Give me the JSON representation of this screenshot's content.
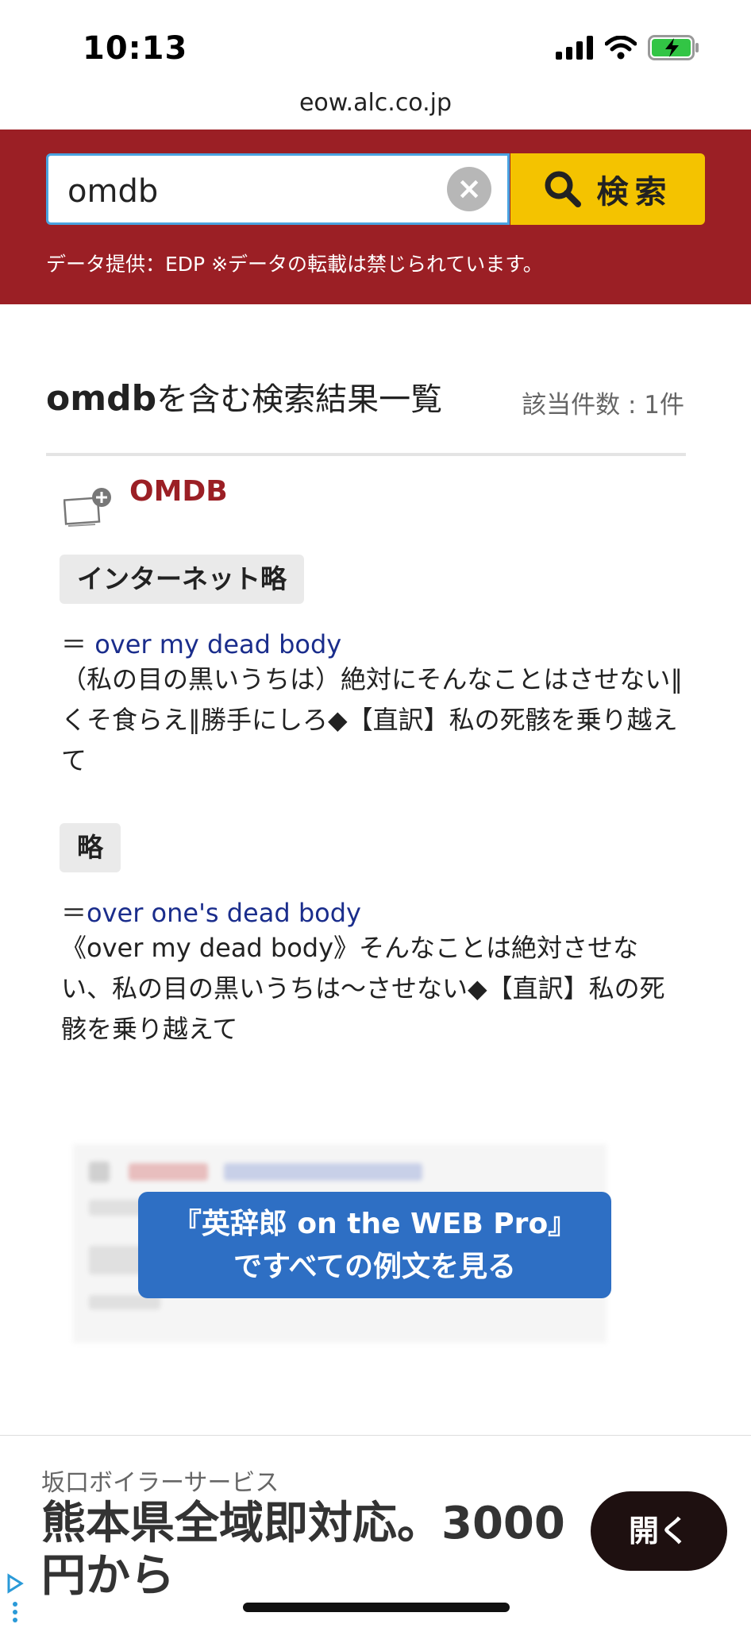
{
  "status": {
    "time": "10:13"
  },
  "browser": {
    "url": "eow.alc.co.jp"
  },
  "search": {
    "query": "omdb",
    "button_label": "検索",
    "data_note": "データ提供：EDP ※データの転載は禁じられています。"
  },
  "results": {
    "title_term": "omdb",
    "title_suffix": "を含む検索結果一覧",
    "count": "該当件数 : 1件"
  },
  "entry": {
    "word": "OMDB",
    "senses": [
      {
        "tag": "インターネット略",
        "eq_prefix": "＝ ",
        "eq_link": "over my dead body",
        "definition": "（私の目の黒いうちは）絶対にそんなことはさせない∥くそ食らえ∥勝手にしろ◆【直訳】私の死骸を乗り越えて"
      },
      {
        "tag": "略",
        "eq_prefix": "＝",
        "eq_link": "over one's dead body",
        "definition": "《over my dead body》そんなことは絶対させない、私の目の黒いうちは～させない◆【直訳】私の死骸を乗り越えて"
      }
    ]
  },
  "promo": {
    "line1": "『英辞郎 on the WEB Pro』",
    "line2": "ですべての例文を見る"
  },
  "ad": {
    "sponsor": "坂口ボイラーサービス",
    "headline": "熊本県全域即対応。3000円から",
    "button": "開く"
  }
}
